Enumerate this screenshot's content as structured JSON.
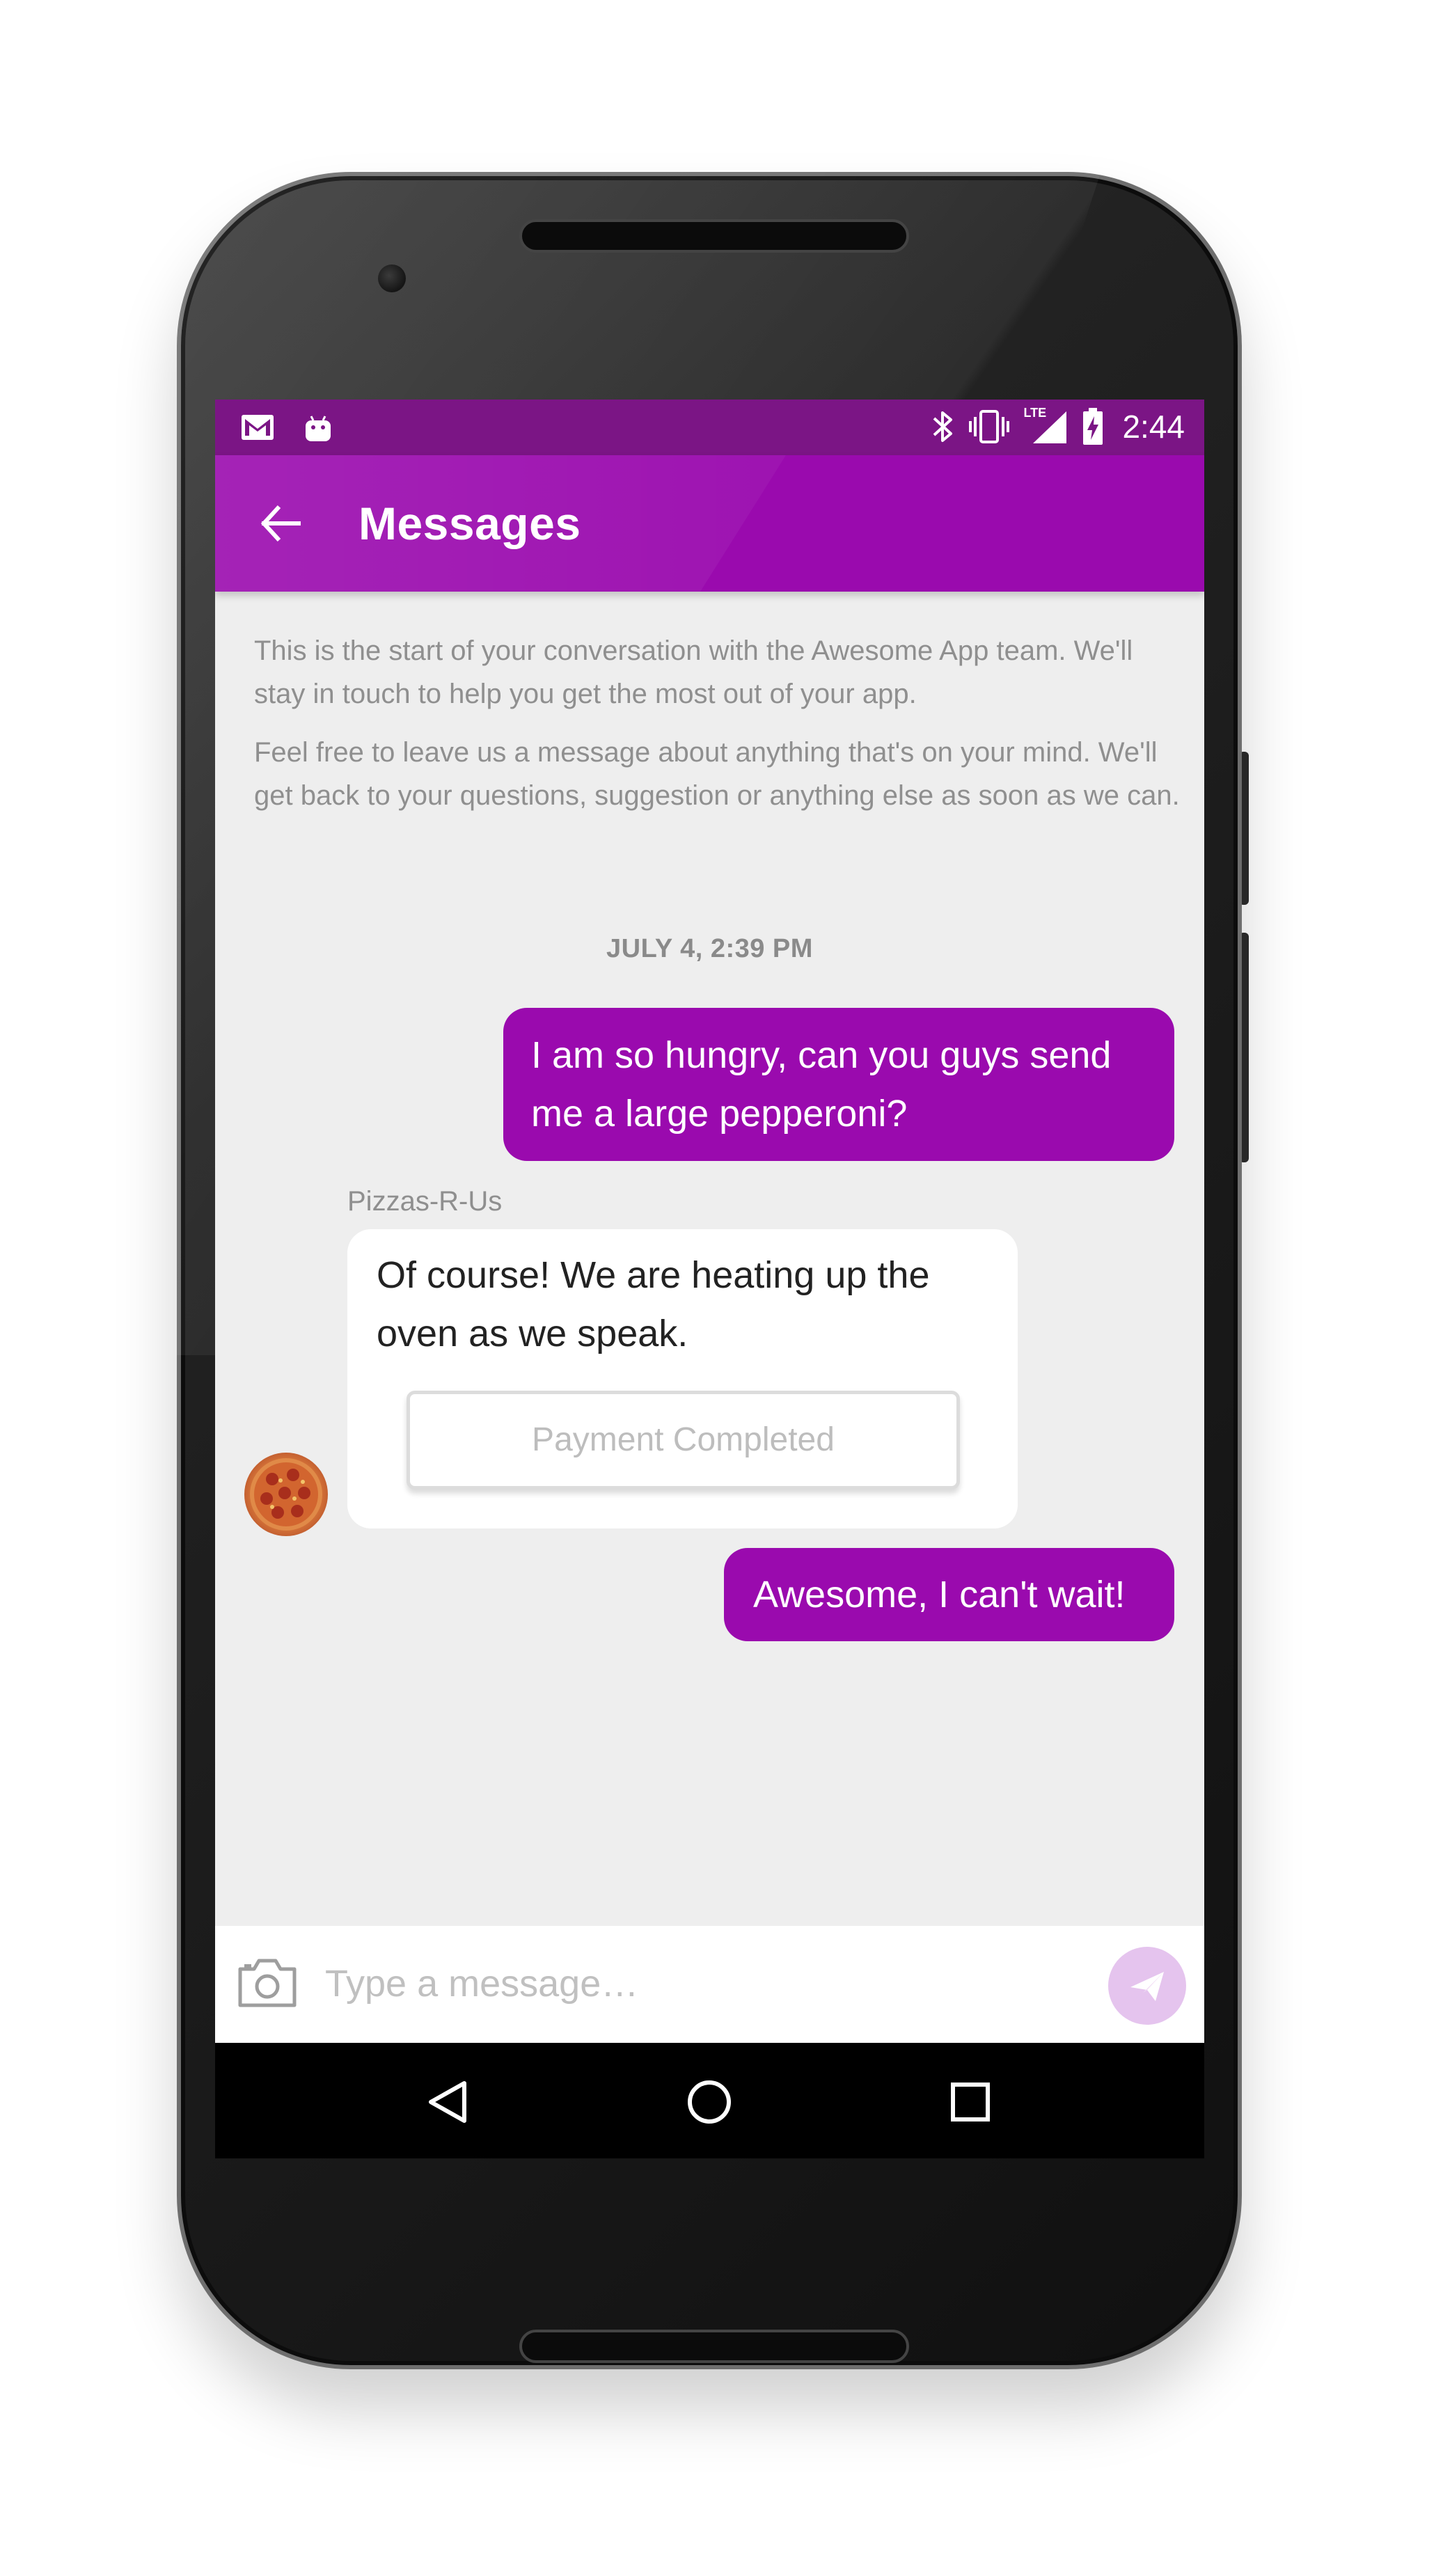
{
  "status_bar": {
    "time": "2:44",
    "network_label": "LTE",
    "icons": [
      "gmail-icon",
      "android-icon",
      "bluetooth-icon",
      "vibrate-icon",
      "lte-signal-icon",
      "battery-charging-icon"
    ]
  },
  "toolbar": {
    "title": "Messages",
    "back_icon": "arrow-back-icon"
  },
  "intro": {
    "paragraph_1": "This is the start of your conversation with the Awesome App team. We'll stay in touch to help you get the most out of your app.",
    "paragraph_2": "Feel free to leave us a message about anything that's on your mind. We'll get back to your questions, suggestion or anything else as soon as we can."
  },
  "conversation": {
    "timestamp": "JULY 4, 2:39 PM",
    "messages": [
      {
        "direction": "outgoing",
        "text": "I am so hungry, can you guys send me a large pepperoni?"
      },
      {
        "direction": "incoming",
        "sender": "Pizzas-R-Us",
        "text": "Of course! We are heating up the oven as we speak.",
        "action_label": "Payment Completed"
      },
      {
        "direction": "outgoing",
        "text": "Awesome, I can't wait!"
      }
    ]
  },
  "composer": {
    "placeholder": "Type a message…",
    "value": ""
  },
  "colors": {
    "status_bar": "#7b1585",
    "primary": "#9a0aae",
    "background": "#eeeeee",
    "send_button": "#e5c4ee"
  }
}
